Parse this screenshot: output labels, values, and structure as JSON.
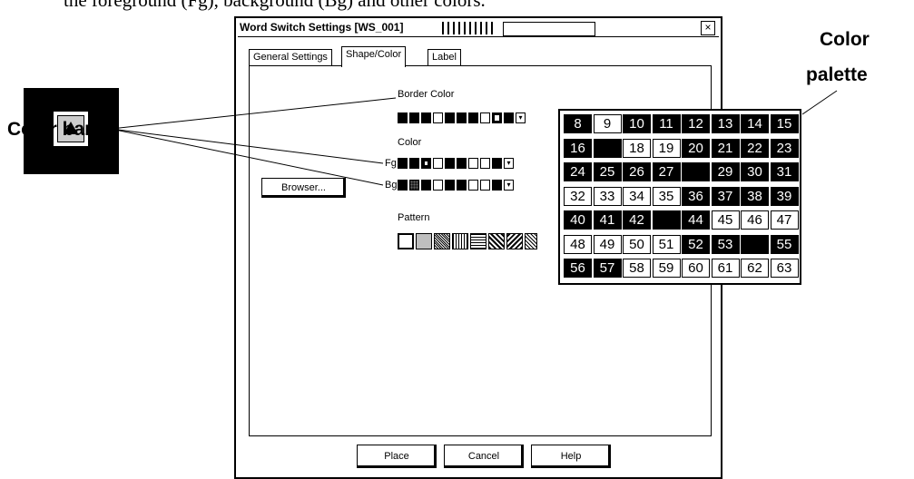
{
  "caption": "the foreground (Fg), background (Bg) and other colors.",
  "dialog": {
    "title": "Word Switch Settings [WS_001]",
    "close_glyph": "×",
    "tabs": [
      "General Settings",
      "Shape/Color",
      "Label"
    ],
    "active_tab": "Shape/Color",
    "browser_button": "Browser...",
    "border_color_label": "Border Color",
    "color_label": "Color",
    "fg_label": "Fg",
    "bg_label": "Bg",
    "pattern_label": "Pattern",
    "buttons": {
      "place": "Place",
      "cancel": "Cancel",
      "help": "Help"
    }
  },
  "swatches": {
    "border_color": [
      "black",
      "black",
      "black",
      "white",
      "black",
      "black",
      "black",
      "white",
      "thick",
      "black",
      "black"
    ],
    "fg": [
      "black",
      "black",
      "dot",
      "white",
      "black",
      "black",
      "white",
      "white",
      "black",
      "black"
    ],
    "bg": [
      "black",
      "dark",
      "black",
      "white",
      "black",
      "black",
      "white",
      "white",
      "black",
      "black"
    ]
  },
  "palette": {
    "cells": [
      [
        "8",
        "black"
      ],
      [
        "9",
        "white"
      ],
      [
        "10",
        "black"
      ],
      [
        "11",
        "black"
      ],
      [
        "12",
        "black"
      ],
      [
        "13",
        "black"
      ],
      [
        "14",
        "black"
      ],
      [
        "15",
        "black"
      ],
      [
        "16",
        "black"
      ],
      [
        "",
        "black"
      ],
      [
        "18",
        "white"
      ],
      [
        "19",
        "white"
      ],
      [
        "20",
        "black"
      ],
      [
        "21",
        "black"
      ],
      [
        "22",
        "black"
      ],
      [
        "23",
        "black"
      ],
      [
        "24",
        "black"
      ],
      [
        "25",
        "black"
      ],
      [
        "26",
        "black"
      ],
      [
        "27",
        "black"
      ],
      [
        "",
        "black"
      ],
      [
        "29",
        "black"
      ],
      [
        "30",
        "black"
      ],
      [
        "31",
        "black"
      ],
      [
        "32",
        "white"
      ],
      [
        "33",
        "white"
      ],
      [
        "34",
        "white"
      ],
      [
        "35",
        "white"
      ],
      [
        "36",
        "black"
      ],
      [
        "37",
        "black"
      ],
      [
        "38",
        "black"
      ],
      [
        "39",
        "black"
      ],
      [
        "40",
        "black"
      ],
      [
        "41",
        "black"
      ],
      [
        "42",
        "black"
      ],
      [
        "",
        "black"
      ],
      [
        "44",
        "black"
      ],
      [
        "45",
        "white"
      ],
      [
        "46",
        "white"
      ],
      [
        "47",
        "white"
      ],
      [
        "48",
        "white"
      ],
      [
        "49",
        "white"
      ],
      [
        "50",
        "white"
      ],
      [
        "51",
        "white"
      ],
      [
        "52",
        "black"
      ],
      [
        "53",
        "black"
      ],
      [
        "",
        "black"
      ],
      [
        "55",
        "black"
      ],
      [
        "56",
        "black"
      ],
      [
        "57",
        "black"
      ],
      [
        "58",
        "white"
      ],
      [
        "59",
        "white"
      ],
      [
        "60",
        "white"
      ],
      [
        "61",
        "white"
      ],
      [
        "62",
        "white"
      ],
      [
        "63",
        "white"
      ]
    ]
  },
  "callouts": {
    "color_bar": "Color bar",
    "color_palette_line1": "Color",
    "color_palette_line2": "palette"
  }
}
